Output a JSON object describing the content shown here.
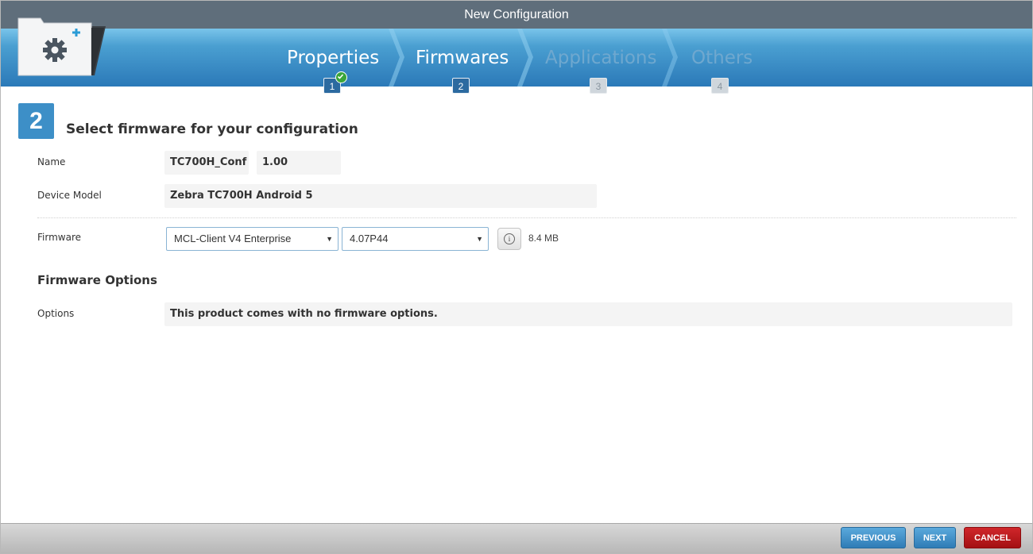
{
  "window": {
    "title": "New Configuration"
  },
  "wizard": {
    "steps": [
      {
        "label": "Properties",
        "number": "1",
        "state": "completed"
      },
      {
        "label": "Firmwares",
        "number": "2",
        "state": "active"
      },
      {
        "label": "Applications",
        "number": "3",
        "state": "inactive"
      },
      {
        "label": "Others",
        "number": "4",
        "state": "inactive"
      }
    ],
    "folder_icon": "folder-gear-plus-icon"
  },
  "main": {
    "step_number": "2",
    "heading": "Select firmware for your configuration",
    "name_label": "Name",
    "name_value": "TC700H_Conf",
    "version_value": "1.00",
    "device_model_label": "Device Model",
    "device_model_value": "Zebra TC700H Android 5",
    "firmware_label": "Firmware",
    "firmware_select": "MCL-Client V4 Enterprise",
    "version_select": "4.07P44",
    "firmware_size": "8.4 MB",
    "options_heading": "Firmware Options",
    "options_label": "Options",
    "options_value": "This product comes with no firmware options."
  },
  "footer": {
    "previous_label": "PREVIOUS",
    "next_label": "NEXT",
    "cancel_label": "CANCEL"
  },
  "colors": {
    "accent": "#3d8fc7",
    "titlebar": "#5f6e7b",
    "cancel": "#b81a1d"
  }
}
